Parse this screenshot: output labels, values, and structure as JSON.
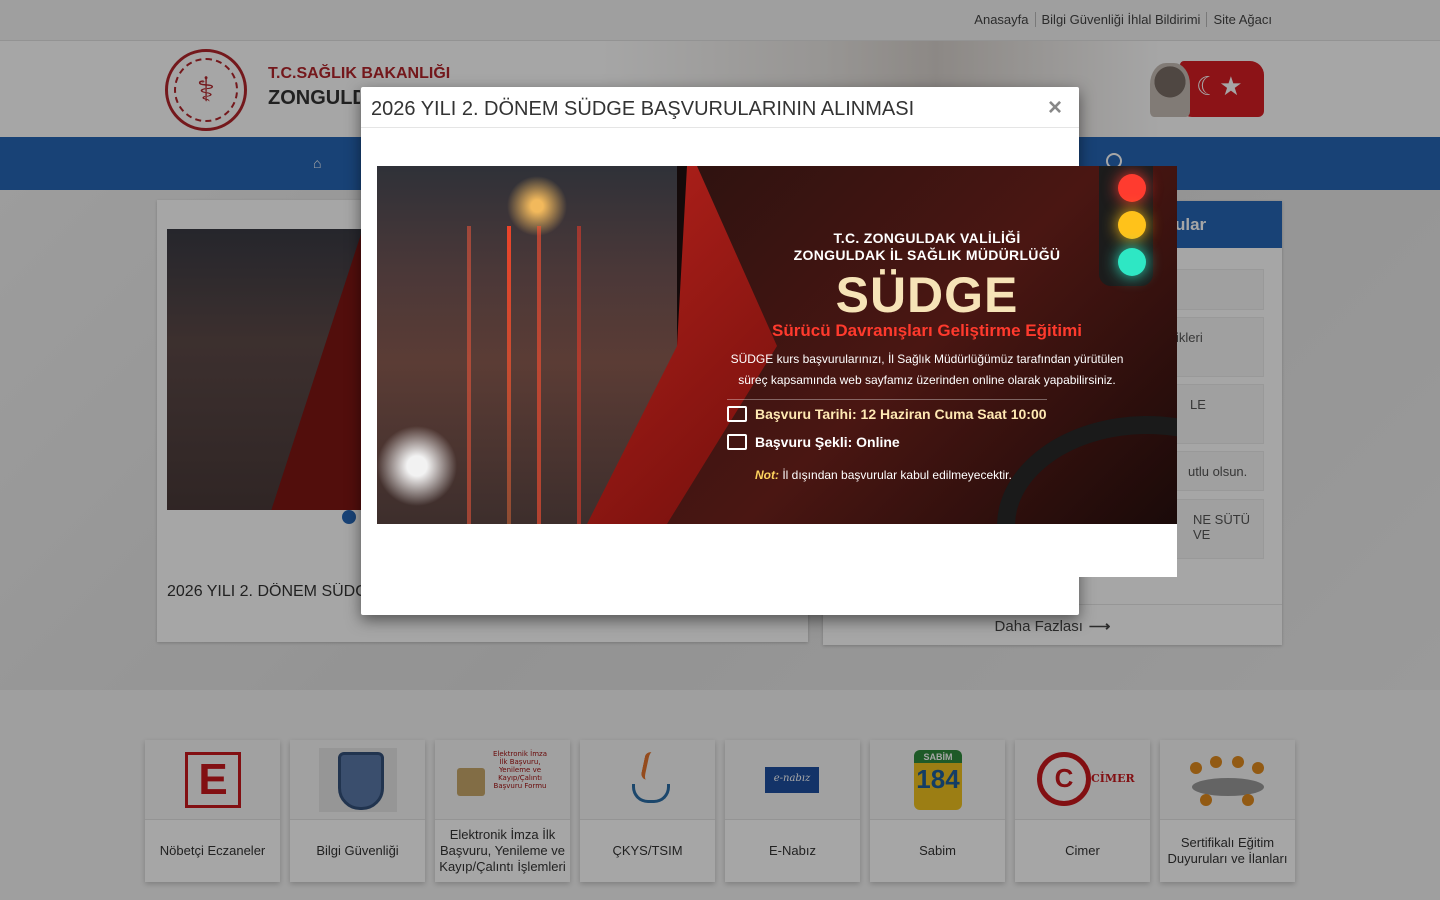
{
  "top_links": [
    "Anasayfa",
    "Bilgi Güvenliği İhlal Bildirimi",
    "Site Ağacı"
  ],
  "header": {
    "ministry": "T.C.SAĞLIK BAKANLIĞI",
    "directorate": "ZONGULDAK İL SAĞLIK MÜDÜRLÜĞÜ"
  },
  "news": {
    "title": "2026 YILI 2. DÖNEM SÜDGE BAŞVURULARININ ALINMASI"
  },
  "announcements": {
    "header": "Duyurular",
    "items": [
      "",
      "Değerlendirme Gerçekleştirilen Sağlık Tesislerinin Bilgi ve Belgeleri Güncellenmiş Genel Bilgilendirme Esaslı Değişiklikleri",
      "İL SAĞLIK MÜDÜRLÜĞÜ HALK SAĞLIĞI HİZMETLERİ BAŞKANLIĞI HİZMET BİNASI İLE",
      "Bayramınız kutlu olsun.",
      "TÜRKİYE ANNE SÜTÜ VE"
    ],
    "visible_items": [
      "",
      "ikleri",
      "LE",
      "utlu olsun.",
      "NE SÜTÜ VE"
    ],
    "more": "Daha Fazlası"
  },
  "quick_links": [
    {
      "label": "Nöbetçi Eczaneler",
      "icon": "pharmacy-e-icon"
    },
    {
      "label": "Bilgi Güvenliği",
      "icon": "security-shield-icon"
    },
    {
      "label": "Elektronik İmza İlk Başvuru, Yenileme ve Kayıp/Çalıntı İşlemleri",
      "icon": "e-signature-icon",
      "icon_text": "Elektronik İmza İlk Başvuru, Yenileme ve Kayıp/Çalıntı Başvuru Formu"
    },
    {
      "label": "ÇKYS/TSIM",
      "icon": "java-icon"
    },
    {
      "label": "E-Nabız",
      "icon": "enabiz-icon",
      "icon_text": "e-nabız"
    },
    {
      "label": "Sabim",
      "icon": "sabim-icon",
      "icon_text": "SABİM",
      "icon_number": "184"
    },
    {
      "label": "Cimer",
      "icon": "cimer-icon",
      "icon_text": "CİMER"
    },
    {
      "label": "Sertifikalı Eğitim Duyuruları ve İlanları",
      "icon": "meeting-icon"
    }
  ],
  "modal": {
    "title": "2026 YILI 2. DÖNEM SÜDGE BAŞVURULARININ ALINMASI",
    "close": "×",
    "banner": {
      "org1": "T.C. ZONGULDAK VALİLİĞİ",
      "org2": "ZONGULDAK İL SAĞLIK MÜDÜRLÜĞÜ",
      "main": "SÜDGE",
      "subtitle": "Sürücü Davranışları Geliştirme Eğitimi",
      "desc1": "SÜDGE kurs başvurularınızı, İl Sağlık Müdürlüğümüz tarafından yürütülen",
      "desc2": "süreç kapsamında web sayfamız üzerinden online olarak yapabilirsiniz.",
      "date": "Başvuru Tarihi: 12 Haziran Cuma Saat 10:00",
      "mode": "Başvuru Şekli: Online",
      "note_prefix": "Not:",
      "note": "İl dışından başvurular kabul edilmeyecektir."
    }
  },
  "colors": {
    "nav_blue": "#2566b6",
    "brand_red": "#b3262b",
    "banner_red": "#ff3a2d"
  }
}
